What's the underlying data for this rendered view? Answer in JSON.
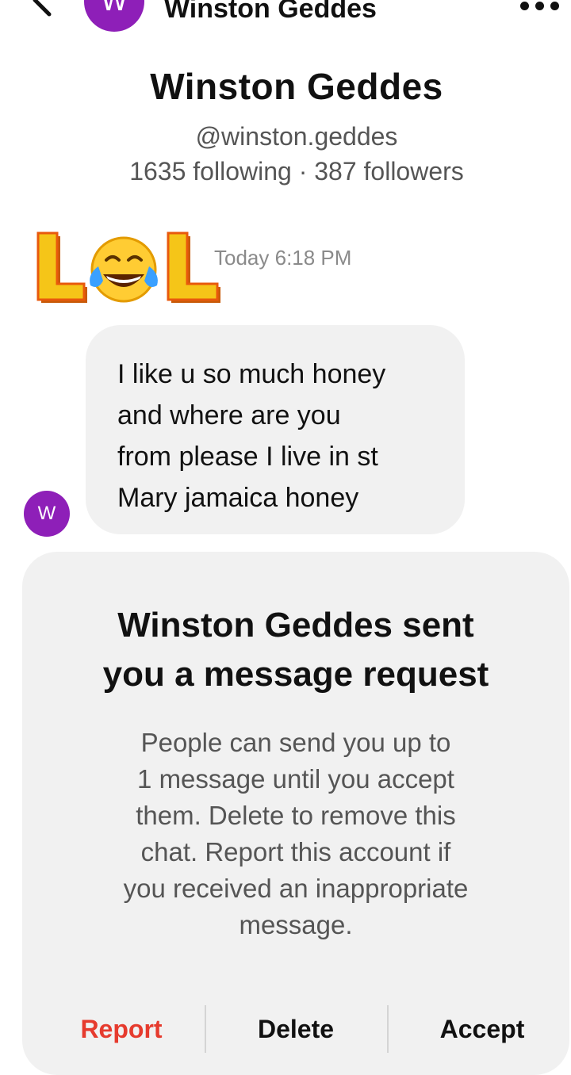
{
  "header": {
    "avatar_letter": "W",
    "title": "Winston Geddes",
    "back_icon": "chevron-left-icon",
    "more_icon": "more-dots-icon"
  },
  "profile": {
    "name": "Winston Geddes",
    "handle": "@winston.geddes",
    "counts": "1635 following · 387 followers"
  },
  "sticker": {
    "text": "LOL",
    "icon": "laughing-crying-emoji-icon"
  },
  "timestamp": "Today 6:18 PM",
  "message": {
    "avatar_letter": "W",
    "lines": [
      "I like u so much honey",
      "and where are you",
      "from please I live in st",
      "Mary jamaica honey"
    ]
  },
  "request": {
    "title_lines": [
      "Winston Geddes sent",
      "you a message request"
    ],
    "body_lines": [
      "People can send you up to",
      "1 message until you accept",
      "them. Delete to remove this",
      "chat. Report this account if",
      "you received an inappropriate",
      "message."
    ],
    "report_label": "Report",
    "delete_label": "Delete",
    "accept_label": "Accept"
  },
  "colors": {
    "avatar": "#8e1fb8",
    "report": "#e63b2e",
    "bubble": "#f1f1f1",
    "lol_yellow": "#f5c518",
    "lol_orange": "#e8590c"
  }
}
